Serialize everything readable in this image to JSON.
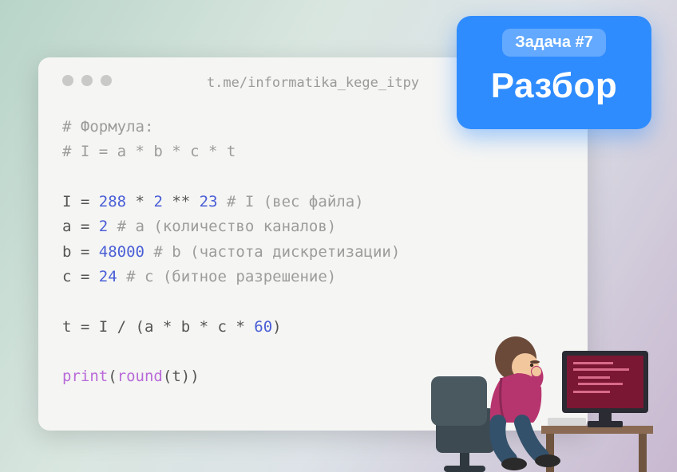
{
  "url": "t.me/informatika_kege_itpy",
  "badge": {
    "top": "Задача #7",
    "main": "Разбор"
  },
  "code": {
    "c1": "# Формула:",
    "c2": "# I = a * b  * c * t",
    "l1": {
      "v": "I",
      "eq": " = ",
      "n1": "288",
      "op1": " * ",
      "n2": "2",
      "op2": " ** ",
      "n3": "23",
      "cm": "  # I (вес файла)"
    },
    "l2": {
      "v": "a",
      "eq": " = ",
      "n": "2",
      "cm": "  # a (количество каналов)"
    },
    "l3": {
      "v": "b",
      "eq": " = ",
      "n": "48000",
      "cm": "  # b (частота дискретизации)"
    },
    "l4": {
      "v": "c",
      "eq": " = ",
      "n": "24",
      "cm": "  # c (битное разрешение)"
    },
    "l5": {
      "text": "t = I / (a * b * c * 60)",
      "v": "t",
      "eq": " = ",
      "rest": "I / (a * b * c * ",
      "n": "60",
      "close": ")"
    },
    "l6": {
      "fn1": "print",
      "p1": "(",
      "fn2": "round",
      "p2": "(",
      "arg": "t",
      "p3": "))"
    }
  }
}
